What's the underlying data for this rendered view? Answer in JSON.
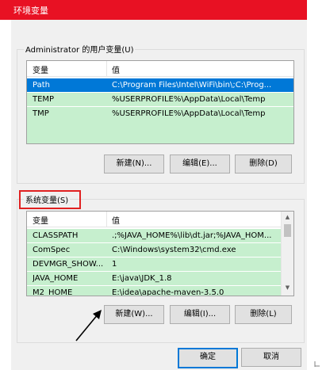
{
  "window": {
    "title": "环境变量"
  },
  "user_vars": {
    "group_label": "Administrator 的用户变量(U)",
    "columns": [
      "变量",
      "值"
    ],
    "rows": [
      {
        "name": "Path",
        "value": "C:\\Program Files\\Intel\\WiFi\\bin\\;C:\\Prog...",
        "selected": true
      },
      {
        "name": "TEMP",
        "value": "%USERPROFILE%\\AppData\\Local\\Temp",
        "selected": false
      },
      {
        "name": "TMP",
        "value": "%USERPROFILE%\\AppData\\Local\\Temp",
        "selected": false
      }
    ],
    "buttons": {
      "new": "新建(N)...",
      "edit": "编辑(E)...",
      "delete": "删除(D)"
    }
  },
  "sys_vars": {
    "group_label": "系统变量(S)",
    "columns": [
      "变量",
      "值"
    ],
    "rows": [
      {
        "name": "CLASSPATH",
        "value": ".;%JAVA_HOME%\\lib\\dt.jar;%JAVA_HOM..."
      },
      {
        "name": "ComSpec",
        "value": "C:\\Windows\\system32\\cmd.exe"
      },
      {
        "name": "DEVMGR_SHOW...",
        "value": "1"
      },
      {
        "name": "JAVA_HOME",
        "value": "E:\\java\\JDK_1.8"
      },
      {
        "name": "M2_HOME",
        "value": "E:\\idea\\apache-maven-3.5.0"
      }
    ],
    "buttons": {
      "new": "新建(W)...",
      "edit": "编辑(I)...",
      "delete": "删除(L)"
    }
  },
  "dialog_buttons": {
    "ok": "确定",
    "cancel": "取消"
  },
  "colors": {
    "titlebar": "#e81123",
    "row_highlight": "#c6efce",
    "selection": "#0078d7",
    "annotation": "#e02020"
  },
  "icons": {
    "scroll_up": "chevron-up-icon",
    "scroll_down": "chevron-down-icon",
    "annotation_arrow": "arrow-icon",
    "resize": "resize-grip-icon"
  }
}
